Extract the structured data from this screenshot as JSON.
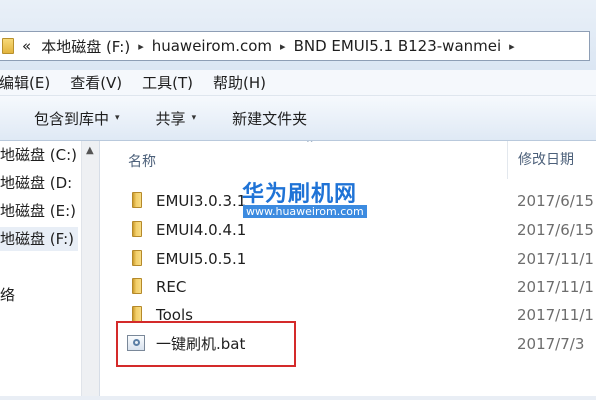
{
  "address_bar": {
    "overflow": "«",
    "crumbs": [
      "本地磁盘 (F:)",
      "huaweirom.com",
      "BND EMUI5.1 B123-wanmei"
    ],
    "separator": "▸"
  },
  "menu": {
    "items": [
      "编辑(E)",
      "查看(V)",
      "工具(T)",
      "帮助(H)"
    ]
  },
  "toolbar": {
    "include_label": "包含到库中",
    "share_label": "共享",
    "new_folder_label": "新建文件夹",
    "caret": "▾"
  },
  "nav": {
    "items": [
      "地磁盘 (C:)",
      "地磁盘 (D:",
      "地磁盘 (E:)",
      "地磁盘 (F:)",
      "络"
    ],
    "selected_index": 3
  },
  "columns": {
    "name": "名称",
    "date": "修改日期"
  },
  "files": [
    {
      "name": "EMUI3.0.3.1",
      "date": "2017/6/15",
      "icon": "folder-icon"
    },
    {
      "name": "EMUI4.0.4.1",
      "date": "2017/6/15",
      "icon": "folder-icon"
    },
    {
      "name": "EMUI5.0.5.1",
      "date": "2017/11/1",
      "icon": "folder-icon"
    },
    {
      "name": "REC",
      "date": "2017/11/1",
      "icon": "folder-icon"
    },
    {
      "name": "Tools",
      "date": "2017/11/1",
      "icon": "folder-icon"
    },
    {
      "name": "一键刷机.bat",
      "date": "2017/7/3",
      "icon": "batch-file-icon"
    }
  ],
  "watermark": {
    "title": "华为刷机网",
    "url": "www.huaweirom.com"
  },
  "colors": {
    "highlight": "#d42a2a",
    "watermark": "#1f73d6"
  }
}
